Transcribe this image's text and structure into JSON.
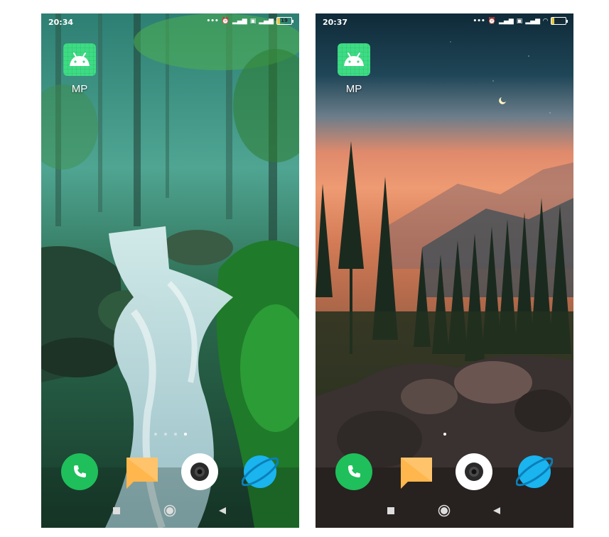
{
  "screens": [
    {
      "status": {
        "time": "20:34",
        "battery": "19",
        "battery_level": 0.19
      },
      "app": {
        "label": "MP"
      },
      "page_dots": 4,
      "active_dot": 3,
      "wallpaper": "forest-waterfall"
    },
    {
      "status": {
        "time": "20:37",
        "battery": "18",
        "battery_level": 0.18
      },
      "app": {
        "label": "MP"
      },
      "page_dots": 1,
      "active_dot": 0,
      "wallpaper": "pine-forest-sunset"
    }
  ],
  "dock_icons": [
    "phone-icon",
    "messages-icon",
    "camera-icon",
    "browser-icon"
  ],
  "nav_icons": [
    "recents-icon",
    "home-icon",
    "back-icon"
  ],
  "colors": {
    "android_green": "#3ddc84",
    "phone_green": "#1fbf5b",
    "browser_blue": "#1ab4ef",
    "message_orange": "#ffb74d",
    "battery_yellow": "#e6c64d"
  }
}
